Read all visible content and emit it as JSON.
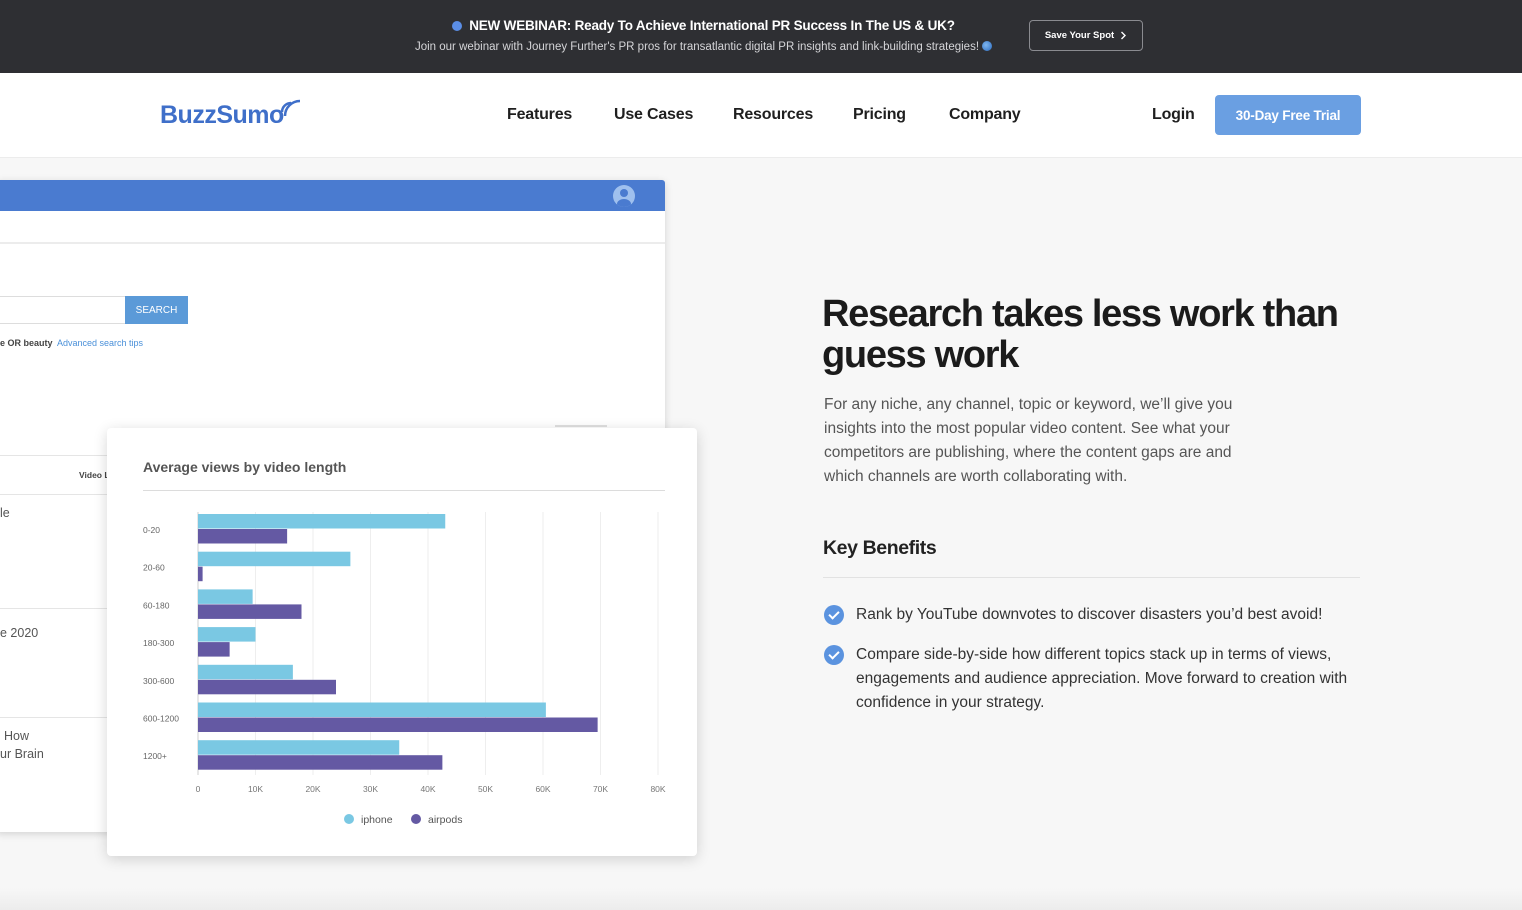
{
  "banner": {
    "title": "NEW WEBINAR: Ready To Achieve International PR Success In The US & UK?",
    "subtitle": "Join our webinar with Journey Further's PR pros for transatlantic digital PR insights and link-building strategies!",
    "cta_label": "Save Your Spot",
    "dot_color": "#5b8ee6"
  },
  "nav": {
    "logo_text": "BuzzSumo",
    "items": [
      "Features",
      "Use Cases",
      "Resources",
      "Pricing",
      "Company"
    ],
    "login": "Login",
    "trial": "30-Day Free Trial",
    "accent": "#6a9fe2"
  },
  "app_mock": {
    "search_button": "SEARCH",
    "hint_text": "e OR beauty",
    "hint_link": "Advanced search tips",
    "column_header": "Video L",
    "row_fragments": [
      "le",
      "e 2020",
      "How",
      "ur Brain"
    ]
  },
  "chart_card": {
    "title": "Average views by video length"
  },
  "chart_data": {
    "type": "bar",
    "orientation": "horizontal",
    "title": "Average views by video length",
    "categories": [
      "0-20",
      "20-60",
      "60-180",
      "180-300",
      "300-600",
      "600-1200",
      "1200+"
    ],
    "series": [
      {
        "name": "iphone",
        "color": "#7ac8e3",
        "values": [
          43000,
          26500,
          9500,
          10000,
          16500,
          60500,
          35000
        ]
      },
      {
        "name": "airpods",
        "color": "#6459a3",
        "values": [
          15500,
          800,
          18000,
          5500,
          24000,
          69500,
          42500
        ]
      }
    ],
    "x_ticks": [
      "0",
      "10K",
      "20K",
      "30K",
      "40K",
      "50K",
      "60K",
      "70K",
      "80K"
    ],
    "xlim": [
      0,
      80000
    ],
    "grid": true,
    "legend": "bottom"
  },
  "hero": {
    "headline": "Research takes less work than guess work",
    "intro": "For any niche, any channel, topic or keyword, we’ll give you insights into the most popular video content. See what your competitors are publishing, where the content gaps are and which channels are worth collaborating with.",
    "benefits_title": "Key Benefits",
    "benefits": [
      "Rank by YouTube downvotes to discover disasters you’d best avoid!",
      "Compare side-by-side how different topics stack up in terms of views, engagements and audience appreciation. Move forward to creation with confidence in your strategy."
    ],
    "check_color": "#5b93df"
  }
}
